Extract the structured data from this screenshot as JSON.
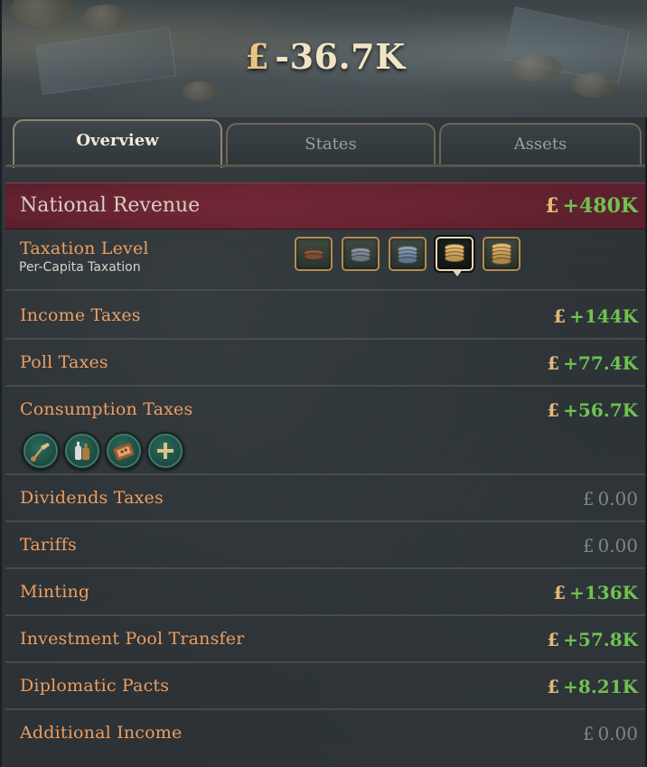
{
  "header": {
    "currency_symbol": "£",
    "balance": "-36.7K"
  },
  "tabs": [
    {
      "label": "Overview",
      "active": true
    },
    {
      "label": "States",
      "active": false
    },
    {
      "label": "Assets",
      "active": false
    }
  ],
  "revenue": {
    "title": "National Revenue",
    "currency_symbol": "£",
    "value": "+480K"
  },
  "taxation": {
    "label": "Taxation Level",
    "current_level": "Per-Capita Taxation",
    "levels": [
      {
        "icon": "copper-coins-icon",
        "selected": false
      },
      {
        "icon": "silver-coins-icon",
        "selected": false
      },
      {
        "icon": "blue-silver-coins-icon",
        "selected": false
      },
      {
        "icon": "gold-coins-icon",
        "selected": true
      },
      {
        "icon": "gold-coin-stack-icon",
        "selected": false
      }
    ]
  },
  "rows": [
    {
      "label": "Income Taxes",
      "currency": "£",
      "value": "+144K",
      "positive": true
    },
    {
      "label": "Poll Taxes",
      "currency": "£",
      "value": "+77.4K",
      "positive": true
    },
    {
      "label": "Consumption Taxes",
      "currency": "£",
      "value": "+56.7K",
      "positive": true
    },
    {
      "label": "Dividends Taxes",
      "currency": "£",
      "value": "0.00",
      "positive": false
    },
    {
      "label": "Tariffs",
      "currency": "£",
      "value": "0.00",
      "positive": false
    },
    {
      "label": "Minting",
      "currency": "£",
      "value": "+136K",
      "positive": true
    },
    {
      "label": "Investment Pool Transfer",
      "currency": "£",
      "value": "+57.8K",
      "positive": true
    },
    {
      "label": "Diplomatic Pacts",
      "currency": "£",
      "value": "+8.21K",
      "positive": true
    },
    {
      "label": "Additional Income",
      "currency": "£",
      "value": "0.00",
      "positive": false
    }
  ],
  "consumption_goods": [
    {
      "icon": "bell-icon"
    },
    {
      "icon": "liquor-bottles-icon"
    },
    {
      "icon": "cigar-box-icon"
    },
    {
      "icon": "add-icon"
    }
  ],
  "colors": {
    "positive": "#6fc24f",
    "neutral": "#7f8584",
    "label": "#ee9d5f",
    "banner": "#6a2533"
  }
}
